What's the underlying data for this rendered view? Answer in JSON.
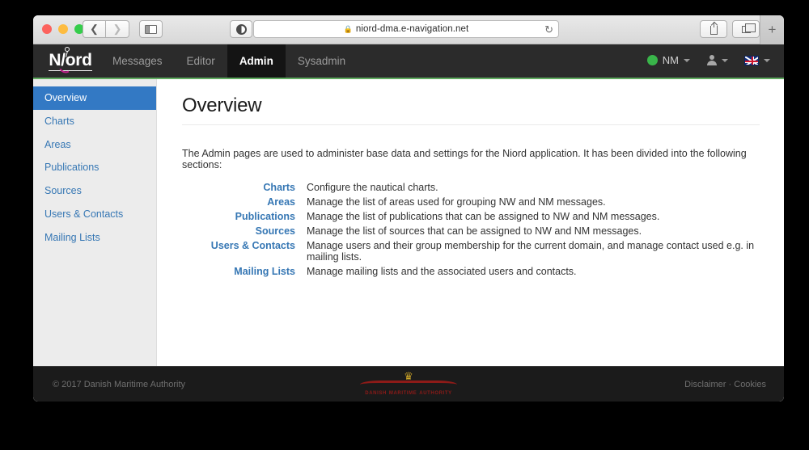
{
  "browser": {
    "url": "niord-dma.e-navigation.net",
    "lock_icon": "lock-icon",
    "reload_icon": "reload-icon",
    "back_icon": "chevron-left-icon",
    "forward_icon": "chevron-right-icon",
    "sidebar_icon": "sidebar-toggle-icon",
    "reader_icon": "reader-view-icon",
    "share_icon": "share-icon",
    "tabs_icon": "show-tabs-icon",
    "new_tab_label": "+"
  },
  "topnav": {
    "logo_text": "N/ord",
    "items": [
      {
        "label": "Messages",
        "active": false
      },
      {
        "label": "Editor",
        "active": false
      },
      {
        "label": "Admin",
        "active": true
      },
      {
        "label": "Sysadmin",
        "active": false
      }
    ],
    "right": {
      "domain_label": "NM",
      "domain_status_color": "#39b54a",
      "user_icon": "person-icon",
      "language_icon": "uk-flag-icon",
      "caret_icon": "chevron-down-icon"
    },
    "accent_color": "#5eaa5e",
    "background_color": "#2b2b2b"
  },
  "sidebar": {
    "items": [
      {
        "label": "Overview",
        "active": true
      },
      {
        "label": "Charts",
        "active": false
      },
      {
        "label": "Areas",
        "active": false
      },
      {
        "label": "Publications",
        "active": false
      },
      {
        "label": "Sources",
        "active": false
      },
      {
        "label": "Users & Contacts",
        "active": false
      },
      {
        "label": "Mailing Lists",
        "active": false
      }
    ],
    "active_background": "#3379c4",
    "link_color": "#3677b4"
  },
  "main": {
    "title": "Overview",
    "intro": "The Admin pages are used to administer base data and settings for the Niord application. It has been divided into the following sections:",
    "sections": [
      {
        "term": "Charts",
        "description": "Configure the nautical charts."
      },
      {
        "term": "Areas",
        "description": "Manage the list of areas used for grouping NW and NM messages."
      },
      {
        "term": "Publications",
        "description": "Manage the list of publications that can be assigned to NW and NM messages."
      },
      {
        "term": "Sources",
        "description": "Manage the list of sources that can be assigned to NW and NM messages."
      },
      {
        "term": "Users & Contacts",
        "description": "Manage users and their group membership for the current domain, and manage contact used e.g. in mailing lists."
      },
      {
        "term": "Mailing Lists",
        "description": "Manage mailing lists and the associated users and contacts."
      }
    ]
  },
  "footer": {
    "copyright": "© 2017 Danish Maritime Authority",
    "logo_text": "Danish Maritime Authority",
    "crown_icon": "crown-icon",
    "links": [
      {
        "label": "Disclaimer"
      },
      {
        "label": "Cookies"
      }
    ],
    "separator": "·"
  }
}
